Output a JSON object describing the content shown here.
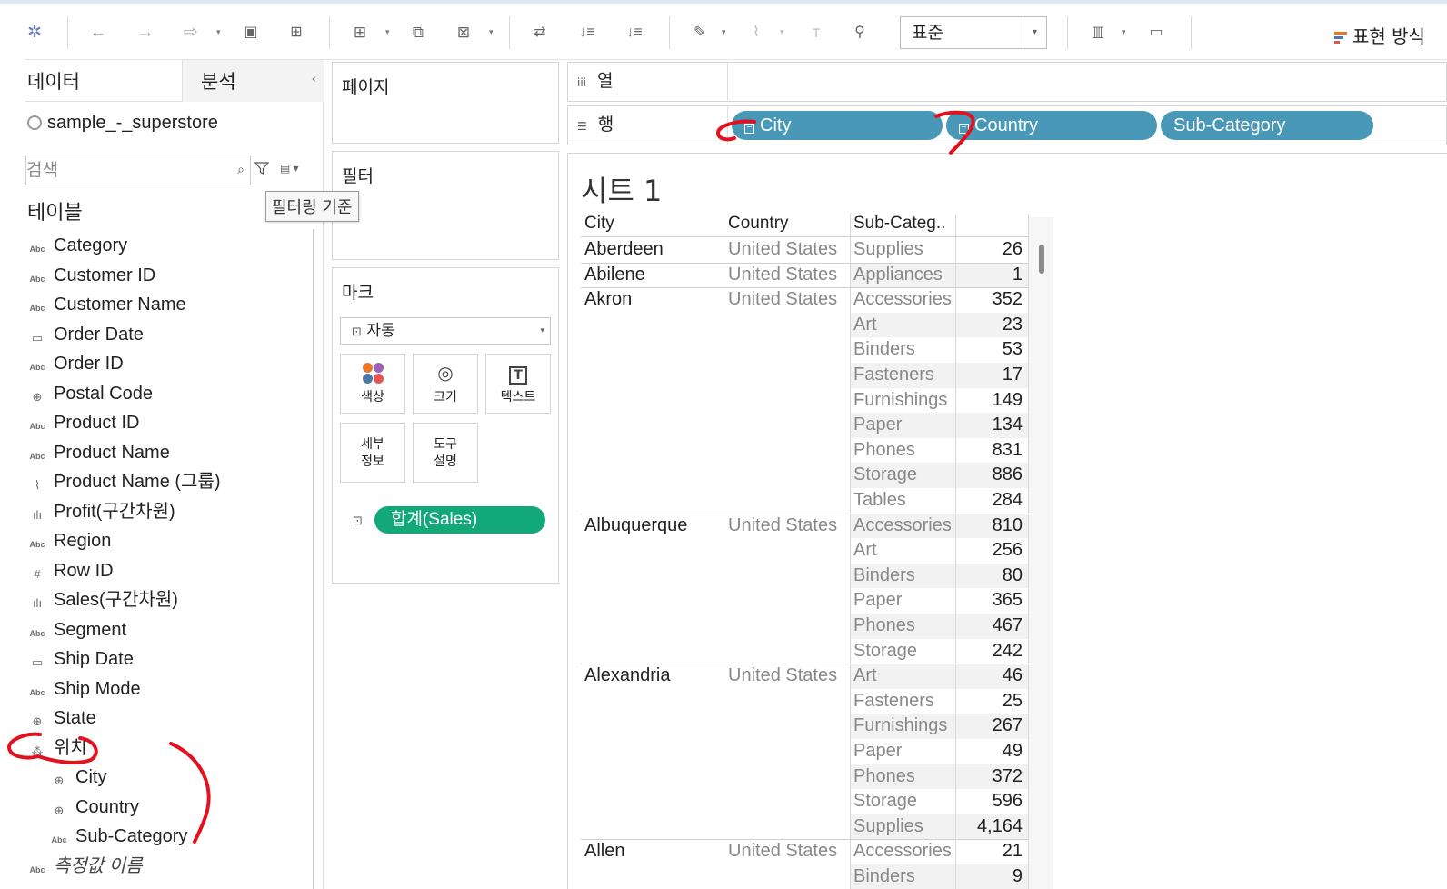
{
  "toolbar": {
    "view_select_value": "표준",
    "show_me_label": "표현 방식"
  },
  "sidebar": {
    "tab_data": "데이터",
    "tab_analysis": "분석",
    "datasource": "sample_-_superstore",
    "search_placeholder": "검색",
    "tooltip": "필터링 기준",
    "tables_title": "테이블",
    "fields": [
      {
        "label": "Category",
        "icon": "Abc"
      },
      {
        "label": "Customer ID",
        "icon": "Abc"
      },
      {
        "label": "Customer Name",
        "icon": "Abc"
      },
      {
        "label": "Order Date",
        "icon": "calendar-icon"
      },
      {
        "label": "Order ID",
        "icon": "Abc"
      },
      {
        "label": "Postal Code",
        "icon": "globe-icon"
      },
      {
        "label": "Product ID",
        "icon": "Abc"
      },
      {
        "label": "Product Name",
        "icon": "Abc"
      },
      {
        "label": "Product Name (그룹)",
        "icon": "paperclip-icon"
      },
      {
        "label": "Profit(구간차원)",
        "icon": "histogram-icon"
      },
      {
        "label": "Region",
        "icon": "Abc"
      },
      {
        "label": "Row ID",
        "icon": "hash-icon"
      },
      {
        "label": "Sales(구간차원)",
        "icon": "histogram-icon"
      },
      {
        "label": "Segment",
        "icon": "Abc"
      },
      {
        "label": "Ship Date",
        "icon": "calendar-icon"
      },
      {
        "label": "Ship Mode",
        "icon": "Abc"
      },
      {
        "label": "State",
        "icon": "globe-icon"
      },
      {
        "label": "위치",
        "icon": "hierarchy-icon"
      },
      {
        "label": "City",
        "icon": "globe-icon"
      },
      {
        "label": "Country",
        "icon": "globe-icon"
      },
      {
        "label": "Sub-Category",
        "icon": "Abc"
      },
      {
        "label": "측정값 이름",
        "icon": "Abc"
      }
    ]
  },
  "cards": {
    "pages_title": "페이지",
    "filters_title": "필터",
    "marks_title": "마크",
    "marks_type": "자동",
    "marks_buttons": {
      "color": "색상",
      "size": "크기",
      "text": "텍스트",
      "detail_1": "세부",
      "detail_2": "정보",
      "tooltip_1": "도구",
      "tooltip_2": "설명"
    },
    "marks_pill": "합계(Sales)"
  },
  "shelves": {
    "columns_label": "열",
    "rows_label": "행",
    "row_pills": [
      "City",
      "Country",
      "Sub-Category"
    ]
  },
  "sheet": {
    "title": "시트 1",
    "headers": {
      "city": "City",
      "country": "Country",
      "sub": "Sub-Categ.."
    },
    "rows": [
      {
        "city": "Aberdeen",
        "country": "United States",
        "sub": "Supplies",
        "val": "26"
      },
      {
        "city": "Abilene",
        "country": "United States",
        "sub": "Appliances",
        "val": "1"
      },
      {
        "city": "Akron",
        "country": "United States",
        "sub": "Accessories",
        "val": "352"
      },
      {
        "city": "",
        "country": "",
        "sub": "Art",
        "val": "23"
      },
      {
        "city": "",
        "country": "",
        "sub": "Binders",
        "val": "53"
      },
      {
        "city": "",
        "country": "",
        "sub": "Fasteners",
        "val": "17"
      },
      {
        "city": "",
        "country": "",
        "sub": "Furnishings",
        "val": "149"
      },
      {
        "city": "",
        "country": "",
        "sub": "Paper",
        "val": "134"
      },
      {
        "city": "",
        "country": "",
        "sub": "Phones",
        "val": "831"
      },
      {
        "city": "",
        "country": "",
        "sub": "Storage",
        "val": "886"
      },
      {
        "city": "",
        "country": "",
        "sub": "Tables",
        "val": "284"
      },
      {
        "city": "Albuquerque",
        "country": "United States",
        "sub": "Accessories",
        "val": "810"
      },
      {
        "city": "",
        "country": "",
        "sub": "Art",
        "val": "256"
      },
      {
        "city": "",
        "country": "",
        "sub": "Binders",
        "val": "80"
      },
      {
        "city": "",
        "country": "",
        "sub": "Paper",
        "val": "365"
      },
      {
        "city": "",
        "country": "",
        "sub": "Phones",
        "val": "467"
      },
      {
        "city": "",
        "country": "",
        "sub": "Storage",
        "val": "242"
      },
      {
        "city": "Alexandria",
        "country": "United States",
        "sub": "Art",
        "val": "46"
      },
      {
        "city": "",
        "country": "",
        "sub": "Fasteners",
        "val": "25"
      },
      {
        "city": "",
        "country": "",
        "sub": "Furnishings",
        "val": "267"
      },
      {
        "city": "",
        "country": "",
        "sub": "Paper",
        "val": "49"
      },
      {
        "city": "",
        "country": "",
        "sub": "Phones",
        "val": "372"
      },
      {
        "city": "",
        "country": "",
        "sub": "Storage",
        "val": "596"
      },
      {
        "city": "",
        "country": "",
        "sub": "Supplies",
        "val": "4,164"
      },
      {
        "city": "Allen",
        "country": "United States",
        "sub": "Accessories",
        "val": "21"
      },
      {
        "city": "",
        "country": "",
        "sub": "Binders",
        "val": "9"
      }
    ]
  },
  "colors": {
    "pill_dimension": "#4a98b8",
    "pill_measure": "#13a87a",
    "annotation_red": "#e3101e"
  }
}
